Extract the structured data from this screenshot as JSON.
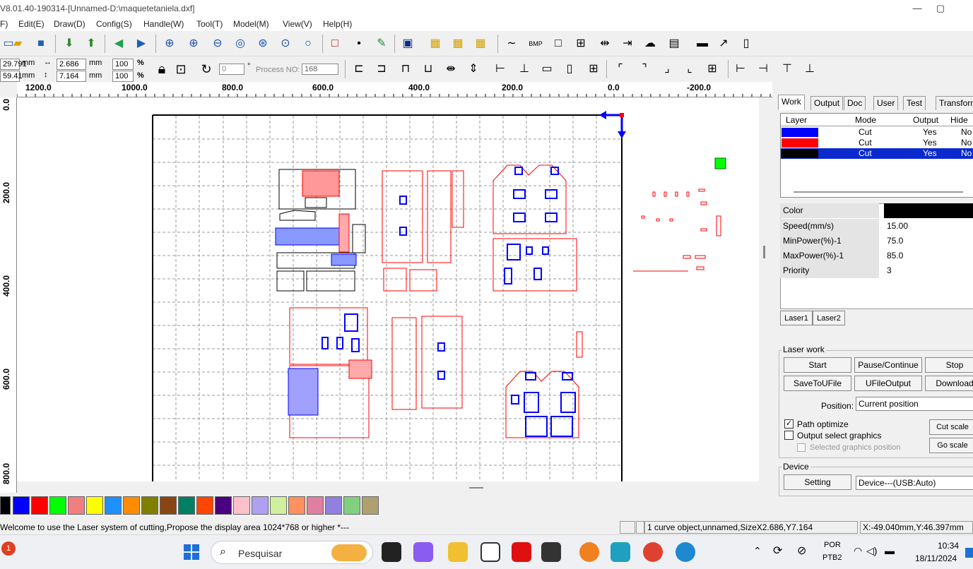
{
  "title": "V8.01.40-190314-[Unnamed-D:\\maquetetaniela.dxf]",
  "window_controls": {
    "minimize": "—",
    "restore": "▢"
  },
  "menu": [
    "F)",
    "Edit(E)",
    "Draw(D)",
    "Config(S)",
    "Handle(W)",
    "Tool(T)",
    "Model(M)",
    "View(V)",
    "Help(H)"
  ],
  "size_fields": {
    "x_pos": "29.791",
    "y_pos": "59.41",
    "unit": "mm",
    "width": "2.686",
    "height": "7.164",
    "scale_w": "100",
    "scale_h": "100",
    "percent": "%"
  },
  "rotate_field": {
    "value": "0",
    "deg": "°"
  },
  "process": {
    "label": "Process NO:",
    "value": "168"
  },
  "ruler_h": [
    "1200.0",
    "1000.0",
    "800.0",
    "600.0",
    "400.0",
    "200.0",
    "0.0",
    "-200.0"
  ],
  "ruler_v": [
    "0.0",
    "200.0",
    "400.0",
    "600.0",
    "800.0"
  ],
  "tabs": [
    "Work",
    "Output",
    "Doc",
    "User",
    "Test",
    "Transform"
  ],
  "layer_table": {
    "headers": [
      "Layer",
      "Mode",
      "Output",
      "Hide"
    ],
    "rows": [
      {
        "color": "#0000ff",
        "mode": "Cut",
        "output": "Yes",
        "hide": "No"
      },
      {
        "color": "#ff0000",
        "mode": "Cut",
        "output": "Yes",
        "hide": "No"
      },
      {
        "color": "#000000",
        "mode": "Cut",
        "output": "Yes",
        "hide": "No"
      }
    ]
  },
  "properties": [
    {
      "label": "Color",
      "value": ""
    },
    {
      "label": "Speed(mm/s)",
      "value": "15.00"
    },
    {
      "label": "MinPower(%)-1",
      "value": "75.0"
    },
    {
      "label": "MaxPower(%)-1",
      "value": "85.0"
    },
    {
      "label": "Priority",
      "value": "3"
    }
  ],
  "laser_tabs": [
    "Laser1",
    "Laser2"
  ],
  "laser_work": {
    "title": "Laser work",
    "start": "Start",
    "pause": "Pause/Continue",
    "stop": "Stop",
    "save": "SaveToUFile",
    "ufile": "UFileOutput",
    "download": "Download",
    "position_label": "Position:",
    "position_value": "Current position",
    "path_optimize": "Path optimize",
    "output_select": "Output select graphics",
    "selected_pos": "Selected graphics position",
    "cut_scale": "Cut scale",
    "go_scale": "Go scale"
  },
  "device": {
    "title": "Device",
    "setting": "Setting",
    "value": "Device---(USB:Auto)"
  },
  "palette": [
    "#000000",
    "#0000ff",
    "#ff0000",
    "#00ff00",
    "#f08080",
    "#ffff00",
    "#1e90ff",
    "#ff8c00",
    "#808000",
    "#8b4513",
    "#008060",
    "#ff4500",
    "#4b0082",
    "#ffc0cb",
    "#b0a0f0",
    "#d0f0a0",
    "#ff9060",
    "#e080a0",
    "#9080e0",
    "#80d080",
    "#b0a070"
  ],
  "status": {
    "welcome": "Welcome to use the Laser system of cutting,Propose the display area 1024*768 or higher *---",
    "object": "1 curve object,unnamed,SizeX2.686,Y7.164",
    "coords": "X:-49.040mm,Y:46.397mm"
  },
  "taskbar": {
    "search_placeholder": "Pesquisar",
    "lang1": "POR",
    "lang2": "PTB2",
    "time": "10:34",
    "date": "18/11/2024"
  }
}
